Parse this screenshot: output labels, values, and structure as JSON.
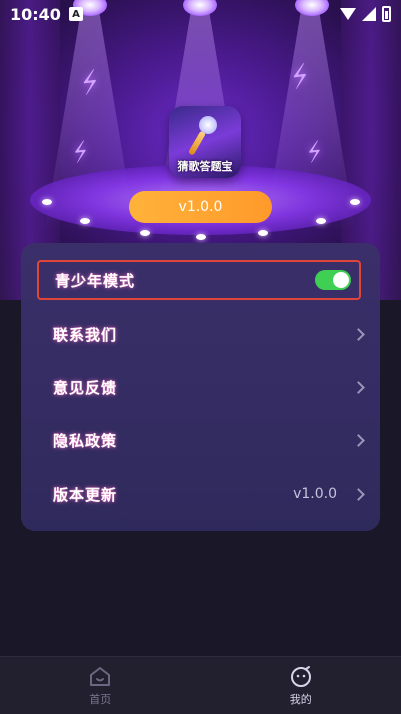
{
  "status_bar": {
    "time": "10:40",
    "badge": "A"
  },
  "app": {
    "icon_name": "猜歌答题宝",
    "version_pill": "v1.0.0"
  },
  "settings": [
    {
      "label": "青少年模式",
      "type": "toggle",
      "on": true
    },
    {
      "label": "联系我们",
      "type": "link"
    },
    {
      "label": "意见反馈",
      "type": "link"
    },
    {
      "label": "隐私政策",
      "type": "link"
    },
    {
      "label": "版本更新",
      "type": "link",
      "value": "v1.0.0"
    }
  ],
  "tabs": [
    {
      "label": "首页",
      "icon": "home-icon",
      "active": false
    },
    {
      "label": "我的",
      "icon": "profile-face-icon",
      "active": true
    }
  ],
  "colors": {
    "accent_orange": "#ffa531",
    "toggle_green": "#3fcf53",
    "highlight_red": "#e0453a"
  }
}
